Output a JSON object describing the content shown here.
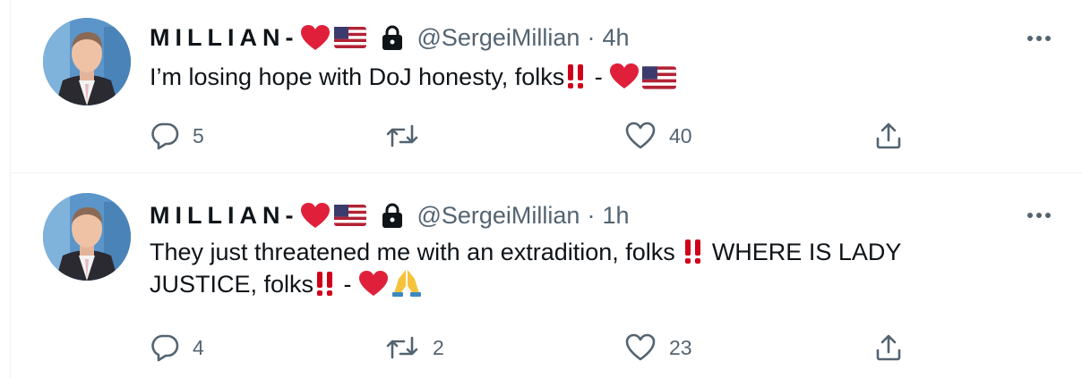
{
  "tweets": [
    {
      "display_name": "MILLIAN-",
      "handle": "@SergeiMillian",
      "separator": "·",
      "time": "4h",
      "text_before": "I’m losing hope with DoJ honesty, folks",
      "text_after": " - ",
      "text_line2": "",
      "reply_count": "5",
      "retweet_count": "",
      "like_count": "40"
    },
    {
      "display_name": "MILLIAN-",
      "handle": "@SergeiMillian",
      "separator": "·",
      "time": "1h",
      "text_before": "They just threatened me with an extradition, folks ",
      "text_after": " WHERE IS LADY",
      "text_line2": "JUSTICE, folks",
      "text_line2_after": " - ",
      "reply_count": "4",
      "retweet_count": "2",
      "like_count": "23"
    }
  ],
  "icons": {
    "reply": "reply-icon",
    "retweet": "retweet-icon",
    "like": "heart-icon",
    "share": "share-icon",
    "more": "more-icon",
    "lock": "lock-icon"
  },
  "colors": {
    "text": "#0f1419",
    "secondary": "#536471",
    "heart_emoji": "#e0203a",
    "exclamation": "#d0021b",
    "divider": "#eff3f4"
  }
}
